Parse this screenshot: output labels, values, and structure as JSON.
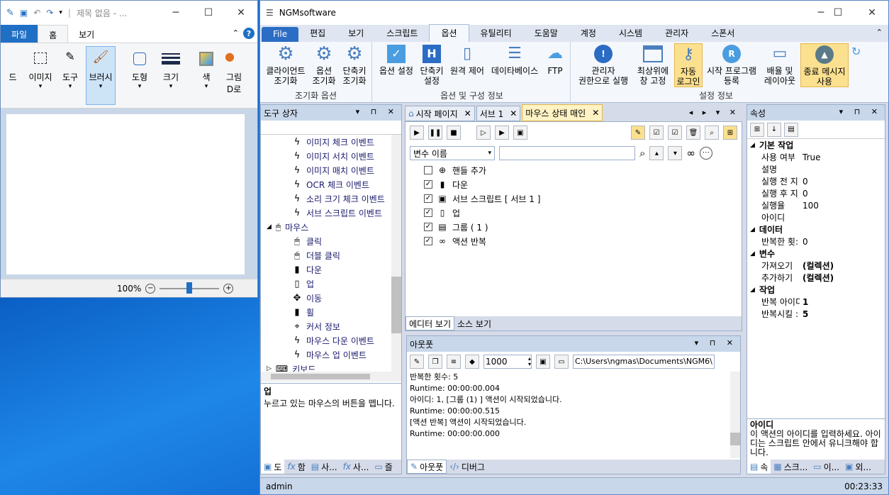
{
  "paint": {
    "title": "제목 없음 - ...",
    "tabs": [
      "파일",
      "홈",
      "보기"
    ],
    "groups": [
      "도구",
      "브러시",
      "도형",
      "크기",
      "색"
    ],
    "partial_left_1": "드",
    "partial_left_2": "이미지",
    "partial_right": "그림",
    "partial_right_2": "D로",
    "zoom": "100%"
  },
  "ngm": {
    "title": "NGMsoftware",
    "tabs": [
      "File",
      "편집",
      "보기",
      "스크립트",
      "옵션",
      "유틸리티",
      "도움말",
      "계정",
      "시스템",
      "관리자",
      "스폰서"
    ],
    "ribbon": {
      "b1": [
        "클라이언트",
        "조기화"
      ],
      "b2": [
        "옵션",
        "조기화"
      ],
      "b3": [
        "단축키",
        "조기화"
      ],
      "g1": "조기화 옵션",
      "b4": [
        "옵션 설정",
        ""
      ],
      "b5": [
        "단축키",
        "설정"
      ],
      "b6": [
        "원격 제어",
        ""
      ],
      "b7": [
        "데이타베이스",
        ""
      ],
      "b8": [
        "FTP",
        ""
      ],
      "g2": "옵션 및 구성 정보",
      "b9": [
        "관리자",
        "권한으로 실행"
      ],
      "b10": [
        "최상위에",
        "창 고정"
      ],
      "b11": [
        "자동",
        "로그인"
      ],
      "b12": [
        "시작 프로그램",
        "등록"
      ],
      "b13": [
        "배율 및",
        "레이아웃"
      ],
      "b14": [
        "종료 메시지",
        "사용"
      ],
      "g3": "설정 정보"
    },
    "toolbox": {
      "title": "도구 상자",
      "items": [
        "이미지 체크 이벤트",
        "이미지 서치 이벤트",
        "이미지 매치 이벤트",
        "OCR 체크 이벤트",
        "소리 크기 체크 이벤트",
        "서브 스크립트 이벤트"
      ],
      "mouse": "마우스",
      "mouse_items": [
        "클릭",
        "더블 클릭",
        "다운",
        "업",
        "이동",
        "휠",
        "커서 정보",
        "마우스 다운 이벤트",
        "마우스 업 이벤트"
      ],
      "keyboard": "키보드",
      "desc_title": "업",
      "desc": "누르고 있는 마우스의 버튼을 뗍니다.",
      "bottom_tabs": [
        "도",
        "함",
        "사...",
        "사...",
        "즐"
      ]
    },
    "doc_tabs": [
      "시작 페이지",
      "서브 1",
      "마우스 상태 매인"
    ],
    "editor": {
      "var_select": "변수 이름",
      "actions": [
        {
          "label": "핸들 추가",
          "checked": false
        },
        {
          "label": "다운",
          "checked": true
        },
        {
          "label": "서브 스크립트 [ 서브 1 ]",
          "checked": true
        },
        {
          "label": "업",
          "checked": true
        },
        {
          "label": "그룹 ( 1 )",
          "checked": true
        },
        {
          "label": "액션 반복",
          "checked": true
        }
      ],
      "view_tabs": [
        "에디터 보기",
        "소스 보기"
      ]
    },
    "output": {
      "title": "아웃풋",
      "count": "1000",
      "path": "C:\\Users\\ngmas\\Documents\\NGM6\\",
      "lines": [
        "반복한 횟수: 5",
        "Runtime: 00:00:00.004",
        "아이디: 1, [그룹 (1) ] 액션이 시작되었습니다.",
        "Runtime: 00:00:00.515",
        "[액션 반복] 액션이 시작되었습니다.",
        "Runtime: 00:00:00.000"
      ],
      "bottom_tabs": [
        "아웃풋",
        "디버그"
      ]
    },
    "props": {
      "title": "속성",
      "cat1": "기본 작업",
      "rows1": [
        [
          "사용 여부",
          "True"
        ],
        [
          "설명",
          ""
        ],
        [
          "실행 전 지",
          "0"
        ],
        [
          "실행 후 지",
          "0"
        ],
        [
          "실행율",
          "100"
        ],
        [
          "아이디",
          ""
        ]
      ],
      "cat2": "데이터",
      "rows2": [
        [
          "반복한 횟:",
          "0"
        ]
      ],
      "cat3": "변수",
      "rows3": [
        [
          "가져오기",
          "(컬렉션)"
        ],
        [
          "추가하기",
          "(컬렉션)"
        ]
      ],
      "cat4": "작업",
      "rows4": [
        [
          "반복 아이디",
          "1"
        ],
        [
          "반복시킬 :",
          "5"
        ]
      ],
      "desc_title": "아이디",
      "desc": "이 액션의 아이디를 입력하세요. 아이디는 스크립트 안에서 유니크해야 합니다.",
      "bottom_tabs": [
        "속",
        "스크...",
        "이...",
        "외..."
      ]
    },
    "status_user": "admin",
    "status_time": "00:23:33"
  }
}
